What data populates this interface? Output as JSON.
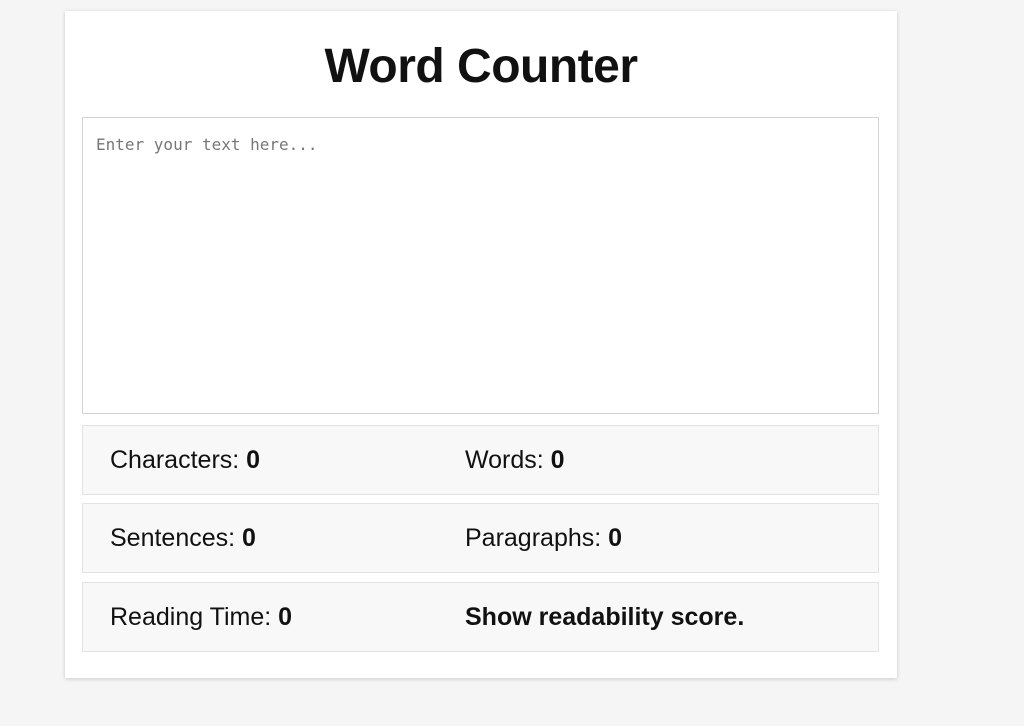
{
  "app": {
    "title": "Word Counter"
  },
  "editor": {
    "placeholder": "Enter your text here...",
    "value": ""
  },
  "stats": {
    "characters": {
      "label": "Characters:",
      "value": "0"
    },
    "words": {
      "label": "Words:",
      "value": "0"
    },
    "sentences": {
      "label": "Sentences:",
      "value": "0"
    },
    "paragraphs": {
      "label": "Paragraphs:",
      "value": "0"
    },
    "reading_time": {
      "label": "Reading Time:",
      "value": "0"
    }
  },
  "readability": {
    "link_label": "Show readability score."
  },
  "colors": {
    "background": "#f5f5f5",
    "card": "#ffffff",
    "stat_row_bg": "#f8f8f8",
    "border": "#d4d4d4",
    "text": "#111111"
  }
}
